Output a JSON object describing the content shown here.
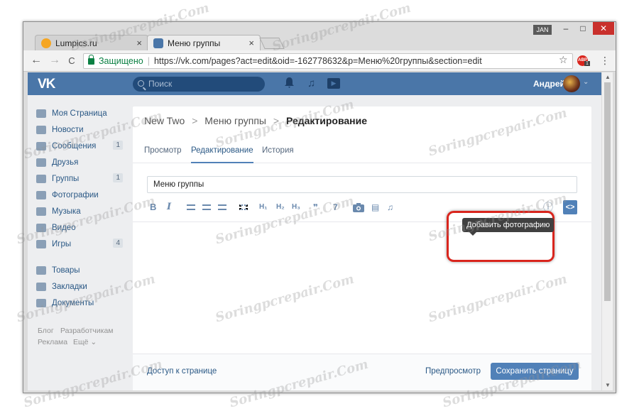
{
  "browser": {
    "tabs": [
      {
        "title": "Lumpics.ru",
        "close": "×"
      },
      {
        "title": "Меню группы",
        "close": "×"
      }
    ],
    "user_badge": "JAN",
    "window_controls": {
      "minimize": "–",
      "maximize": "□",
      "close": "✕"
    },
    "nav": {
      "back": "←",
      "forward": "→",
      "reload": "C"
    },
    "address": {
      "secure_label": "Защищено",
      "separator": "|",
      "url": "https://vk.com/pages?act=edit&oid=-162778632&p=Меню%20группы&section=edit"
    },
    "bookmark_icon": "☆",
    "extension": {
      "label": "ABP",
      "count": "1"
    },
    "menu_icon": "⋮"
  },
  "vk_header": {
    "logo": "VK",
    "search_placeholder": "Поиск",
    "bell_icon": "🔔",
    "music_icon": "♫",
    "play_icon": "▶",
    "user_name": "Андрей",
    "chevron": "⌄"
  },
  "sidebar": {
    "items": [
      {
        "label": "Моя Страница",
        "icon": "home-icon",
        "badge": ""
      },
      {
        "label": "Новости",
        "icon": "news-icon",
        "badge": ""
      },
      {
        "label": "Сообщения",
        "icon": "messages-icon",
        "badge": "1"
      },
      {
        "label": "Друзья",
        "icon": "friends-icon",
        "badge": ""
      },
      {
        "label": "Группы",
        "icon": "groups-icon",
        "badge": "1"
      },
      {
        "label": "Фотографии",
        "icon": "camera-icon",
        "badge": ""
      },
      {
        "label": "Музыка",
        "icon": "music-icon",
        "badge": ""
      },
      {
        "label": "Видео",
        "icon": "video-icon",
        "badge": ""
      },
      {
        "label": "Игры",
        "icon": "games-icon",
        "badge": "4"
      },
      {
        "label": "Товары",
        "icon": "shop-icon",
        "badge": ""
      },
      {
        "label": "Закладки",
        "icon": "star-icon",
        "badge": ""
      },
      {
        "label": "Документы",
        "icon": "document-icon",
        "badge": ""
      }
    ],
    "footer": {
      "blog": "Блог",
      "developers": "Разработчикам",
      "ads": "Реклама",
      "more": "Ещё ⌄"
    }
  },
  "editor": {
    "breadcrumbs": {
      "root": "New Two",
      "section": "Меню группы",
      "current": "Редактирование",
      "sep": ">"
    },
    "tabs": [
      {
        "label": "Просмотр",
        "active": false
      },
      {
        "label": "Редактирование",
        "active": true
      },
      {
        "label": "История",
        "active": false
      }
    ],
    "title_value": "Меню группы",
    "toolbar": {
      "bold": "B",
      "italic": "I",
      "h1": "H₁",
      "h2": "H₂",
      "h3": "H₃",
      "quote": "❞",
      "link": "7",
      "photo": "📷",
      "video": "▤",
      "audio": "♫",
      "info": "ⓘ",
      "code": "<>"
    },
    "tooltip": "Добавить фотографию",
    "footer": {
      "access": "Доступ к странице",
      "preview": "Предпросмотр",
      "save": "Сохранить страницу"
    }
  },
  "watermark": "Soringpcrepair.Com",
  "colors": {
    "vk_blue": "#4a76a8",
    "link": "#2a5885",
    "button": "#5181b8",
    "highlight": "#d9251d"
  }
}
